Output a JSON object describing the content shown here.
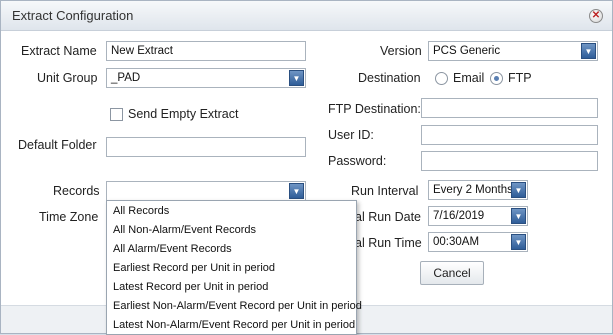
{
  "dialog": {
    "title": "Extract Configuration",
    "close_icon": "close-icon"
  },
  "left": {
    "extract_name_label": "Extract Name",
    "extract_name_value": "New Extract",
    "unit_group_label": "Unit Group",
    "unit_group_value": "_PAD",
    "send_empty_label": "Send Empty Extract",
    "send_empty_checked": false,
    "default_folder_label": "Default Folder",
    "default_folder_value": "",
    "records_label": "Records",
    "records_value": "",
    "time_zone_label": "Time Zone"
  },
  "right": {
    "version_label": "Version",
    "version_value": "PCS Generic",
    "destination_label": "Destination",
    "destination_options": [
      "Email",
      "FTP"
    ],
    "destination_selected": "FTP",
    "ftp_destination_label": "FTP Destination:",
    "ftp_destination_value": "",
    "user_id_label": "User ID:",
    "user_id_value": "",
    "password_label": "Password:",
    "password_value": "",
    "run_interval_label": "Run Interval",
    "run_interval_value": "Every 2 Months",
    "initial_run_date_label": "al Run Date",
    "initial_run_date_value": "7/16/2019",
    "initial_run_time_label": "al Run Time",
    "initial_run_time_value": "00:30AM",
    "cancel_label": "Cancel"
  },
  "records_dropdown": {
    "items": [
      "All Records",
      "All Non-Alarm/Event Records",
      "All Alarm/Event Records",
      "Earliest Record per Unit in period",
      "Latest Record per Unit in period",
      "Earliest Non-Alarm/Event Record per Unit in period",
      "Latest Non-Alarm/Event Record per Unit in period"
    ]
  },
  "colors": {
    "accent": "#2f5d98",
    "dialog_border": "#a9b4c2"
  }
}
